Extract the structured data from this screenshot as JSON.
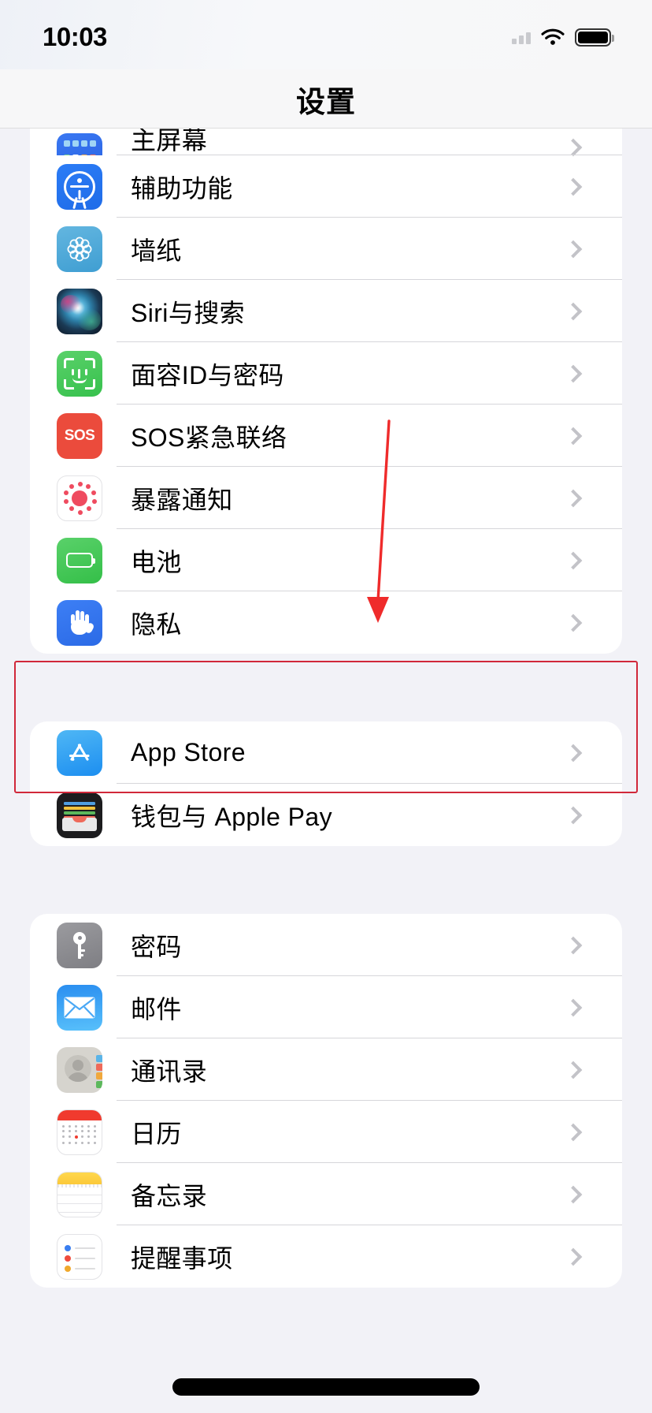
{
  "status_bar": {
    "time": "10:03",
    "signal_icon": "cellular-signal-icon",
    "wifi_icon": "wifi-icon",
    "battery_icon": "battery-full-icon"
  },
  "nav": {
    "title": "设置"
  },
  "colors": {
    "page_background": "#f2f2f7",
    "card_background": "#ffffff",
    "separator": "#d6d6da",
    "chevron": "#c3c3c8",
    "annotation_red": "#d1283a",
    "arrow_red": "#ef2b2b"
  },
  "sections": [
    {
      "name": "system-section",
      "clipped_top": true,
      "rows": [
        {
          "label": "主屏幕",
          "icon": "home-screen-icon",
          "partially_visible": true
        },
        {
          "label": "辅助功能",
          "icon": "accessibility-icon"
        },
        {
          "label": "墙纸",
          "icon": "wallpaper-icon"
        },
        {
          "label": "Siri与搜索",
          "icon": "siri-icon"
        },
        {
          "label": "面容ID与密码",
          "icon": "face-id-icon"
        },
        {
          "label": "SOS紧急联络",
          "icon": "sos-icon"
        },
        {
          "label": "暴露通知",
          "icon": "exposure-notification-icon"
        },
        {
          "label": "电池",
          "icon": "battery-settings-icon"
        },
        {
          "label": "隐私",
          "icon": "privacy-hand-icon",
          "highlighted": true
        }
      ]
    },
    {
      "name": "store-section",
      "rows": [
        {
          "label": "App Store",
          "icon": "app-store-icon"
        },
        {
          "label": "钱包与 Apple Pay",
          "icon": "wallet-icon"
        }
      ]
    },
    {
      "name": "apps-section",
      "rows": [
        {
          "label": "密码",
          "icon": "passwords-key-icon"
        },
        {
          "label": "邮件",
          "icon": "mail-icon"
        },
        {
          "label": "通讯录",
          "icon": "contacts-icon"
        },
        {
          "label": "日历",
          "icon": "calendar-icon"
        },
        {
          "label": "备忘录",
          "icon": "notes-icon"
        },
        {
          "label": "提醒事项",
          "icon": "reminders-icon"
        }
      ]
    }
  ],
  "annotations": {
    "highlight_box": {
      "name": "privacy-row-highlight",
      "target_label": "隐私",
      "color": "#d1283a"
    },
    "arrow": {
      "name": "pointer-arrow",
      "points_to": "隐私",
      "color": "#ef2b2b"
    }
  },
  "home_indicator": {
    "name": "home-indicator"
  }
}
